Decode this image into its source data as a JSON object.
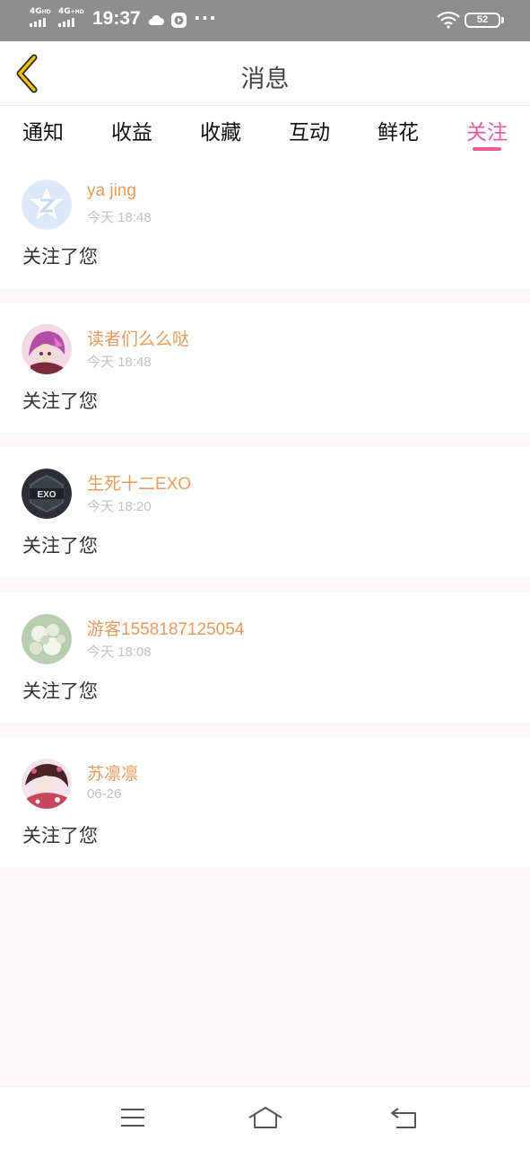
{
  "status_bar": {
    "net1": "4G",
    "net1_sup": "HD",
    "net2": "4G",
    "net2_sup": "+HD",
    "time": "19:37",
    "more": "···",
    "battery": "52"
  },
  "header": {
    "title": "消息",
    "back_icon": "chevron-left-icon",
    "back_color": "#f0c400"
  },
  "tabs": [
    {
      "label": "通知",
      "active": false
    },
    {
      "label": "收益",
      "active": false
    },
    {
      "label": "收藏",
      "active": false
    },
    {
      "label": "互动",
      "active": false
    },
    {
      "label": "鲜花",
      "active": false
    },
    {
      "label": "关注",
      "active": true
    }
  ],
  "accent_color": "#ef5a9c",
  "notifications": [
    {
      "username": "ya jing",
      "time": "今天 18:48",
      "message": "关注了您",
      "avatar": "qzone-logo-avatar"
    },
    {
      "username": "读者们么么哒",
      "time": "今天 18:48",
      "message": "关注了您",
      "avatar": "anime-girl-avatar"
    },
    {
      "username": "生死十二EXO",
      "time": "今天 18:20",
      "message": "关注了您",
      "avatar": "exo-logo-avatar"
    },
    {
      "username": "游客1558187125054",
      "time": "今天 18:08",
      "message": "关注了您",
      "avatar": "flower-photo-avatar"
    },
    {
      "username": "苏凛凛",
      "time": "06-26",
      "message": "关注了您",
      "avatar": "anime-girl-avatar"
    }
  ],
  "nav": {
    "menu_icon": "menu-icon",
    "home_icon": "home-icon",
    "back_icon": "back-icon"
  }
}
